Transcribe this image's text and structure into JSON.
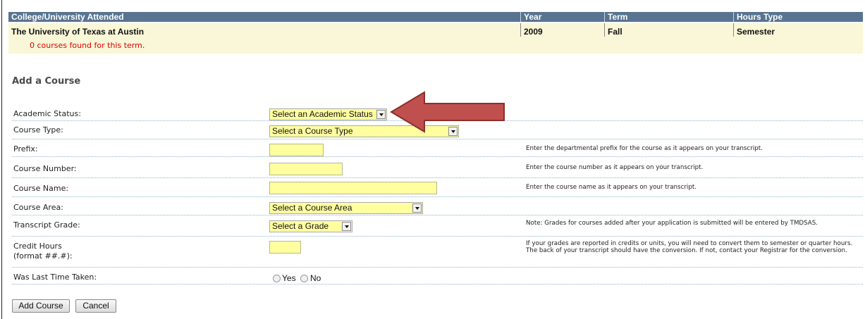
{
  "header": {
    "col_college": "College/University Attended",
    "col_year": "Year",
    "col_term": "Term",
    "col_hours_type": "Hours Type"
  },
  "record": {
    "college": "The University of Texas at Austin",
    "year": "2009",
    "term": "Fall",
    "hours_type": "Semester",
    "message": "0 courses found for this term."
  },
  "section_title": "Add a Course",
  "form": {
    "academic_status": {
      "label": "Academic Status:",
      "selected": "Select an Academic Status"
    },
    "course_type": {
      "label": "Course Type:",
      "selected": "Select a Course Type"
    },
    "prefix": {
      "label": "Prefix:",
      "value": "",
      "help": "Enter the departmental prefix for the course as it appears on your transcript."
    },
    "course_number": {
      "label": "Course Number:",
      "value": "",
      "help": "Enter the course number as it appears on your transcript."
    },
    "course_name": {
      "label": "Course Name:",
      "value": "",
      "help": "Enter the course name as it appears on your transcript."
    },
    "course_area": {
      "label": "Course Area:",
      "selected": "Select a Course Area"
    },
    "transcript_grade": {
      "label": "Transcript Grade:",
      "selected": "Select a Grade",
      "help": "Note:  Grades for courses added after your application is submitted will be entered by TMDSAS."
    },
    "credit_hours": {
      "label_line1": "Credit Hours",
      "label_line2": "(format ##.#):",
      "value": "",
      "help": "If your grades are reported in credits or units, you will need to convert them to semester or quarter hours.  The back of your transcript should have the conversion.  If not, contact your Registrar for the conversion."
    },
    "last_time_taken": {
      "label": "Was Last Time Taken:",
      "yes": "Yes",
      "no": "No"
    }
  },
  "buttons": {
    "add": "Add Course",
    "cancel": "Cancel"
  },
  "colors": {
    "header_bg": "#587490",
    "row_bg": "#f9f7d8",
    "field_bg": "#ffffa0",
    "message": "#e00000",
    "callout_arrow": "#c0504d"
  }
}
